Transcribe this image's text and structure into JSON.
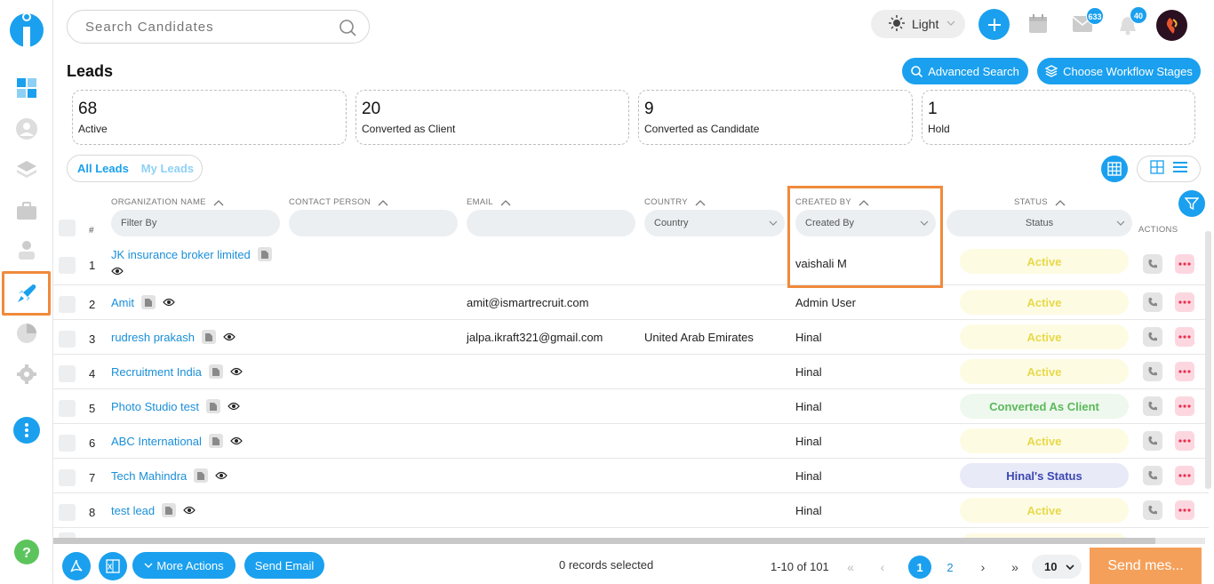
{
  "header": {
    "search_placeholder": "Search Candidates",
    "theme_label": "Light",
    "mail_badge": "633",
    "notification_badge": "40"
  },
  "page": {
    "title": "Leads",
    "advanced_search_label": "Advanced Search",
    "workflow_label": "Choose Workflow Stages"
  },
  "stats": [
    {
      "value": "68",
      "label": "Active"
    },
    {
      "value": "20",
      "label": "Converted as Client"
    },
    {
      "value": "9",
      "label": "Converted as Candidate"
    },
    {
      "value": "1",
      "label": "Hold"
    }
  ],
  "tabs": {
    "all": "All Leads",
    "mine": "My Leads"
  },
  "columns": {
    "index": "#",
    "org": "ORGANIZATION NAME",
    "contact": "CONTACT PERSON",
    "email": "EMAIL",
    "country": "COUNTRY",
    "created_by": "CREATED BY",
    "status": "STATUS",
    "actions": "ACTIONS"
  },
  "filters": {
    "org_placeholder": "Filter By",
    "country": "Country",
    "created_by": "Created By",
    "status": "Status"
  },
  "rows": [
    {
      "idx": "1",
      "org": "JK insurance broker limited",
      "email": "",
      "country": "",
      "created_by": "vaishali M",
      "status": "Active"
    },
    {
      "idx": "2",
      "org": "Amit",
      "email": "amit@ismartrecruit.com",
      "country": "",
      "created_by": "Admin User",
      "status": "Active"
    },
    {
      "idx": "3",
      "org": "rudresh prakash",
      "email": "jalpa.ikraft321@gmail.com",
      "country": "United Arab Emirates",
      "created_by": "Hinal",
      "status": "Active"
    },
    {
      "idx": "4",
      "org": "Recruitment India",
      "email": "",
      "country": "",
      "created_by": "Hinal",
      "status": "Active"
    },
    {
      "idx": "5",
      "org": "Photo Studio test",
      "email": "",
      "country": "",
      "created_by": "Hinal",
      "status": "Converted As Client"
    },
    {
      "idx": "6",
      "org": "ABC International",
      "email": "",
      "country": "",
      "created_by": "Hinal",
      "status": "Active"
    },
    {
      "idx": "7",
      "org": "Tech Mahindra",
      "email": "",
      "country": "",
      "created_by": "Hinal",
      "status": "Hinal's Status"
    },
    {
      "idx": "8",
      "org": "test lead",
      "email": "",
      "country": "",
      "created_by": "Hinal",
      "status": "Active"
    }
  ],
  "footer": {
    "more_actions": "More Actions",
    "send_email": "Send Email",
    "selected": "0 records selected",
    "range": "1-10 of 101",
    "page_current": "1",
    "page_next": "2",
    "per_page": "10",
    "send_message": "Send mes..."
  },
  "colors": {
    "accent": "#1aa0ee",
    "highlight": "#f08a3c",
    "send_message": "#f5a05a"
  }
}
